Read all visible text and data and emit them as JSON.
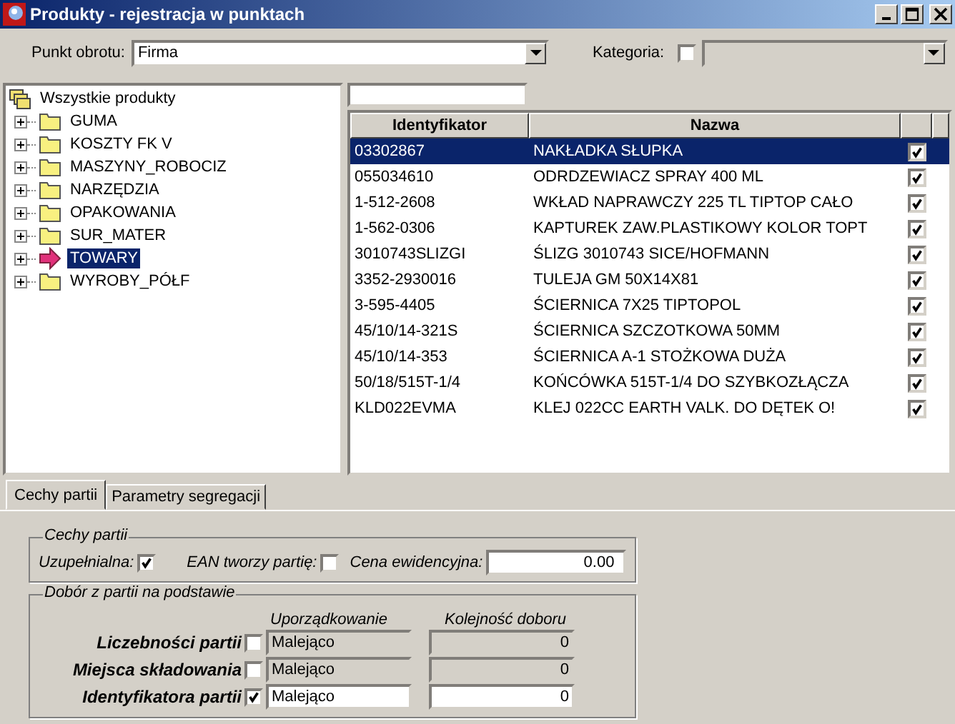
{
  "window": {
    "title": "Produkty - rejestracja w punktach"
  },
  "toolbar": {
    "punkt_label": "Punkt obrotu:",
    "punkt_value": "Firma",
    "kategoria_label": "Kategoria:",
    "kategoria_checked": false
  },
  "tree": {
    "root": "Wszystkie produkty",
    "items": [
      {
        "label": "GUMA",
        "selected": false
      },
      {
        "label": "KOSZTY FK V",
        "selected": false
      },
      {
        "label": "MASZYNY_ROBOCIZ",
        "selected": false
      },
      {
        "label": "NARZĘDZIA",
        "selected": false
      },
      {
        "label": "OPAKOWANIA",
        "selected": false
      },
      {
        "label": "SUR_MATER",
        "selected": false
      },
      {
        "label": "TOWARY",
        "selected": true
      },
      {
        "label": "WYROBY_PÓŁF",
        "selected": false
      }
    ]
  },
  "table": {
    "columns": [
      "Identyfikator",
      "Nazwa"
    ],
    "rows": [
      {
        "id": "03302867",
        "name": "NAKŁADKA SŁUPKA",
        "checked": true,
        "selected": true
      },
      {
        "id": "055034610",
        "name": "ODRDZEWIACZ SPRAY 400 ML",
        "checked": true,
        "selected": false
      },
      {
        "id": "1-512-2608",
        "name": "WKŁAD NAPRAWCZY 225 TL TIPTOP CAŁO",
        "checked": true,
        "selected": false
      },
      {
        "id": "1-562-0306",
        "name": "KAPTUREK ZAW.PLASTIKOWY KOLOR TOPT",
        "checked": true,
        "selected": false
      },
      {
        "id": "3010743SLIZGI",
        "name": "ŚLIZG 3010743 SICE/HOFMANN",
        "checked": true,
        "selected": false
      },
      {
        "id": "3352-2930016",
        "name": "TULEJA GM 50X14X81",
        "checked": true,
        "selected": false
      },
      {
        "id": "3-595-4405",
        "name": "ŚCIERNICA 7X25 TIPTOPOL",
        "checked": true,
        "selected": false
      },
      {
        "id": "45/10/14-321S",
        "name": "ŚCIERNICA SZCZOTKOWA 50MM",
        "checked": true,
        "selected": false
      },
      {
        "id": "45/10/14-353",
        "name": "ŚCIERNICA A-1 STOŻKOWA DUŻA",
        "checked": true,
        "selected": false
      },
      {
        "id": "50/18/515T-1/4",
        "name": "KOŃCÓWKA 515T-1/4 DO SZYBKOZŁĄCZA",
        "checked": true,
        "selected": false
      },
      {
        "id": "KLD022EVMA",
        "name": "KLEJ 022CC EARTH VALK. DO DĘTEK O!",
        "checked": true,
        "selected": false
      }
    ]
  },
  "tabs": [
    {
      "label": "Cechy partii",
      "selected": true
    },
    {
      "label": "Parametry segregacji",
      "selected": false
    }
  ],
  "cechy": {
    "title": "Cechy partii",
    "uzupelnialna_label": "Uzupełnialna:",
    "uzupelnialna_checked": true,
    "ean_label": "EAN tworzy partię:",
    "ean_checked": false,
    "cena_label": "Cena ewidencyjna:",
    "cena_value": "0.00"
  },
  "dobor": {
    "title": "Dobór z partii na podstawie",
    "col_order": "Uporządkowanie",
    "col_seq": "Kolejność doboru",
    "rows": [
      {
        "label": "Liczebności partii",
        "checked": false,
        "order": "Malejąco",
        "seq": "0"
      },
      {
        "label": "Miejsca składowania",
        "checked": false,
        "order": "Malejąco",
        "seq": "0"
      },
      {
        "label": "Identyfikatora partii",
        "checked": true,
        "order": "Malejąco",
        "seq": "0"
      }
    ]
  }
}
